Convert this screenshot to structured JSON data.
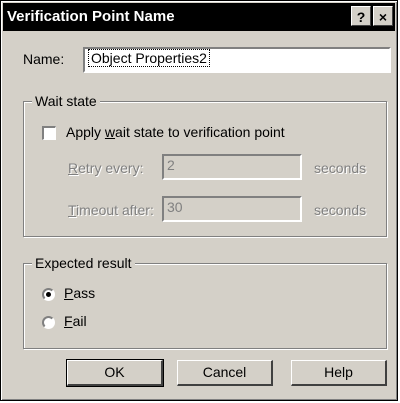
{
  "window": {
    "title": "Verification Point Name",
    "help_button": "?",
    "close_button": "×"
  },
  "name": {
    "label": "Name:",
    "value": "Object Properties2"
  },
  "wait_state": {
    "legend": "Wait state",
    "checkbox_label": "Apply wait state to verification point",
    "checkbox_checked": false,
    "retry_label": "Retry every:",
    "retry_value": "2",
    "retry_unit": "seconds",
    "timeout_label": "Timeout after:",
    "timeout_value": "30",
    "timeout_unit": "seconds"
  },
  "expected_result": {
    "legend": "Expected result",
    "options": [
      {
        "label": "Pass",
        "selected": true
      },
      {
        "label": "Fail",
        "selected": false
      }
    ]
  },
  "buttons": {
    "ok": "OK",
    "cancel": "Cancel",
    "help": "Help"
  }
}
